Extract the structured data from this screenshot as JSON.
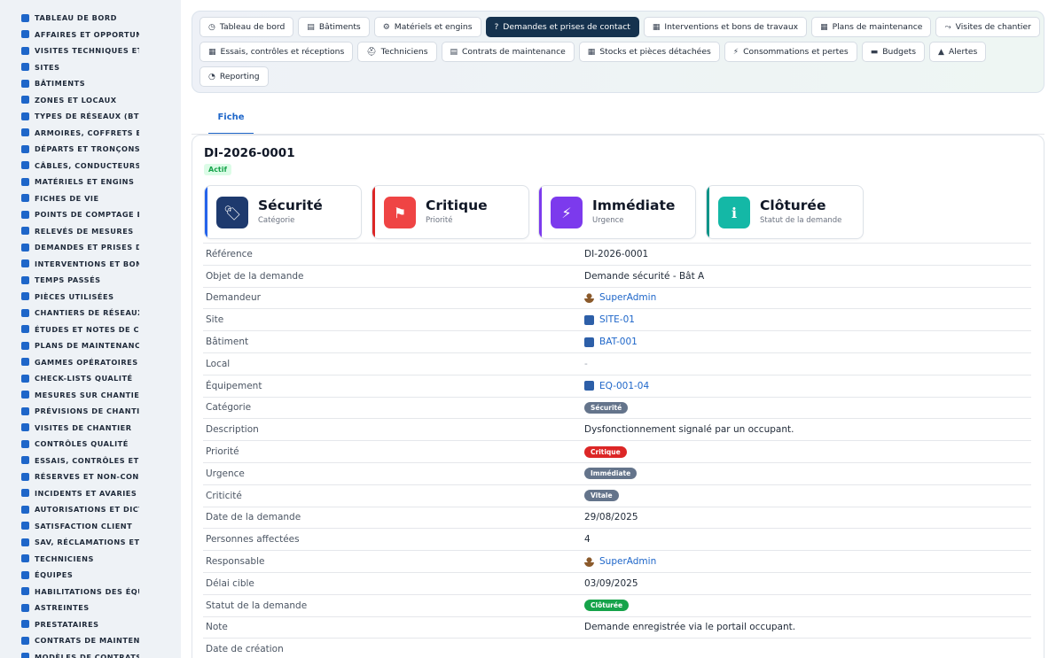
{
  "sidebar": {
    "items": [
      {
        "label": "TABLEAU DE BORD"
      },
      {
        "label": "AFFAIRES ET OPPORTUNITÉS"
      },
      {
        "label": "VISITES TECHNIQUES ET AUDITS"
      },
      {
        "label": "SITES"
      },
      {
        "label": "BÂTIMENTS"
      },
      {
        "label": "ZONES ET LOCAUX"
      },
      {
        "label": "TYPES DE RÉSEAUX (BT / HTA)"
      },
      {
        "label": "ARMOIRES, COFFRETS ET TABLEAUX"
      },
      {
        "label": "DÉPARTS ET TRONÇONS"
      },
      {
        "label": "CÂBLES, CONDUCTEURS"
      },
      {
        "label": "MATÉRIELS ET ENGINS"
      },
      {
        "label": "FICHES DE VIE"
      },
      {
        "label": "POINTS DE COMPTAGE ET"
      },
      {
        "label": "RELEVÉS DE MESURES"
      },
      {
        "label": "DEMANDES ET PRISES DE CONTACT"
      },
      {
        "label": "INTERVENTIONS ET BONS"
      },
      {
        "label": "TEMPS PASSÉS"
      },
      {
        "label": "PIÈCES UTILISÉES"
      },
      {
        "label": "CHANTIERS DE RÉSEAUX"
      },
      {
        "label": "ÉTUDES ET NOTES DE CALCUL"
      },
      {
        "label": "PLANS DE MAINTENANCE"
      },
      {
        "label": "GAMMES OPÉRATOIRES"
      },
      {
        "label": "CHECK-LISTS QUALITÉ"
      },
      {
        "label": "MESURES SUR CHANTIER"
      },
      {
        "label": "PRÉVISIONS DE CHANTIER"
      },
      {
        "label": "VISITES DE CHANTIER"
      },
      {
        "label": "CONTRÔLES QUALITÉ"
      },
      {
        "label": "ESSAIS, CONTRÔLES ET"
      },
      {
        "label": "RÉSERVES ET NON-CONFORMITÉS"
      },
      {
        "label": "INCIDENTS ET AVARIES"
      },
      {
        "label": "AUTORISATIONS ET DICT"
      },
      {
        "label": "SATISFACTION CLIENT"
      },
      {
        "label": "SAV, RÉCLAMATIONS ET GARANTIES"
      },
      {
        "label": "TECHNICIENS"
      },
      {
        "label": "ÉQUIPES"
      },
      {
        "label": "HABILITATIONS DES ÉQUIPES"
      },
      {
        "label": "ASTREINTES"
      },
      {
        "label": "PRESTATAIRES"
      },
      {
        "label": "CONTRATS DE MAINTENANCE"
      },
      {
        "label": "MODÈLES DE CONTRATS"
      }
    ]
  },
  "tabs": {
    "row1": [
      {
        "label": "Tableau de bord",
        "icon": "dashboard-icon",
        "glyph": "◷"
      },
      {
        "label": "Bâtiments",
        "icon": "building-icon",
        "glyph": "▤"
      },
      {
        "label": "Matériels et engins",
        "icon": "gears-icon",
        "glyph": "⚙"
      },
      {
        "label": "Demandes et prises de contact",
        "icon": "question-icon",
        "glyph": "?"
      },
      {
        "label": "Interventions et bons de travaux",
        "icon": "clipboard-icon",
        "glyph": "▦"
      },
      {
        "label": "Plans de maintenance",
        "icon": "calendar-icon",
        "glyph": "▦"
      },
      {
        "label": "Visites de chantier",
        "icon": "route-icon",
        "glyph": "⤳"
      }
    ],
    "row2": [
      {
        "label": "Essais, contrôles et réceptions",
        "icon": "clipboard-check-icon",
        "glyph": "▦"
      },
      {
        "label": "Techniciens",
        "icon": "helmet-icon",
        "glyph": "⛑"
      },
      {
        "label": "Contrats de maintenance",
        "icon": "document-icon",
        "glyph": "▤"
      },
      {
        "label": "Stocks et pièces détachées",
        "icon": "boxes-icon",
        "glyph": "▦"
      },
      {
        "label": "Consommations et pertes",
        "icon": "bolt-icon",
        "glyph": "⚡"
      },
      {
        "label": "Budgets",
        "icon": "money-icon",
        "glyph": "▬"
      },
      {
        "label": "Alertes",
        "icon": "bell-icon",
        "glyph": "▲"
      }
    ],
    "row3": [
      {
        "label": "Reporting",
        "icon": "pie-chart-icon",
        "glyph": "◔"
      }
    ]
  },
  "fiche_tab": "Fiche",
  "record": {
    "id": "DI-2026-0001",
    "status": "Actif"
  },
  "summary": [
    {
      "title": "Sécurité",
      "sub": "Catégorie",
      "color": "#1e3a6e",
      "bar": "#2563eb",
      "icon": "tag-icon",
      "glyph": "🏷"
    },
    {
      "title": "Critique",
      "sub": "Priorité",
      "color": "#ef4444",
      "bar": "#dc2626",
      "icon": "flag-icon",
      "glyph": "⚑"
    },
    {
      "title": "Immédiate",
      "sub": "Urgence",
      "color": "#7c3aed",
      "bar": "#7c3aed",
      "icon": "bolt-icon",
      "glyph": "⚡"
    },
    {
      "title": "Clôturée",
      "sub": "Statut de la demande",
      "color": "#14b8a6",
      "bar": "#0d9488",
      "icon": "info-icon",
      "glyph": "ℹ"
    }
  ],
  "details": [
    {
      "label": "Référence",
      "value": "DI-2026-0001",
      "kind": "text"
    },
    {
      "label": "Objet de la demande",
      "value": "Demande sécurité - Bât A",
      "kind": "text"
    },
    {
      "label": "Demandeur",
      "value": "SuperAdmin",
      "kind": "user"
    },
    {
      "label": "Site",
      "value": "SITE-01",
      "kind": "entity"
    },
    {
      "label": "Bâtiment",
      "value": "BAT-001",
      "kind": "entity"
    },
    {
      "label": "Local",
      "value": "-",
      "kind": "dash"
    },
    {
      "label": "Équipement",
      "value": "EQ-001-04",
      "kind": "entity"
    },
    {
      "label": "Catégorie",
      "value": "Sécurité",
      "kind": "badge",
      "badge_color": "#64748b"
    },
    {
      "label": "Description",
      "value": "Dysfonctionnement signalé par un occupant.",
      "kind": "text"
    },
    {
      "label": "Priorité",
      "value": "Critique",
      "kind": "badge",
      "badge_color": "#dc2626"
    },
    {
      "label": "Urgence",
      "value": "Immédiate",
      "kind": "badge",
      "badge_color": "#64748b"
    },
    {
      "label": "Criticité",
      "value": "Vitale",
      "kind": "badge",
      "badge_color": "#64748b"
    },
    {
      "label": "Date de la demande",
      "value": "29/08/2025",
      "kind": "text"
    },
    {
      "label": "Personnes affectées",
      "value": "4",
      "kind": "text"
    },
    {
      "label": "Responsable",
      "value": "SuperAdmin",
      "kind": "user"
    },
    {
      "label": "Délai cible",
      "value": "03/09/2025",
      "kind": "text"
    },
    {
      "label": "Statut de la demande",
      "value": "Clôturée",
      "kind": "badge",
      "badge_color": "#16a34a"
    },
    {
      "label": "Note",
      "value": "Demande enregistrée via le portail occupant.",
      "kind": "text"
    },
    {
      "label": "Date de création",
      "value": "",
      "kind": "text"
    }
  ]
}
